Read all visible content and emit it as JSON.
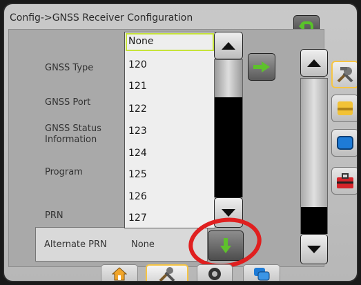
{
  "header": {
    "title": "Config->GNSS Receiver Configuration"
  },
  "labels": {
    "gnss_type": "GNSS Type",
    "gnss_port": "GNSS Port",
    "gnss_status": "GNSS Status Information",
    "program": "Program",
    "prn": "PRN",
    "alternate_prn": "Alternate PRN"
  },
  "dropdown": {
    "options": [
      "None",
      "120",
      "121",
      "122",
      "123",
      "124",
      "125",
      "126",
      "127"
    ],
    "selected": "None"
  },
  "alternate_prn_value": "None",
  "icons": {
    "back": "back-arrow-icon",
    "next": "right-arrow-icon",
    "down": "down-arrow-icon",
    "tools": "tools-icon",
    "home": "home-icon"
  },
  "colors": {
    "accent_green": "#5ec12c",
    "highlight": "#c6e33a",
    "callout": "#e01f1f"
  }
}
